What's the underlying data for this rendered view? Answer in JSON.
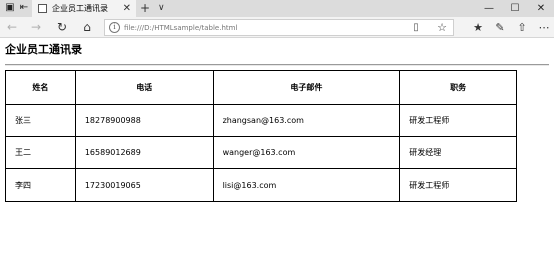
{
  "browser": {
    "tab_title": "企业员工通讯录",
    "url": "file:///D:/HTMLsample/table.html",
    "icons": {
      "tab_actions": "tab-actions-icon",
      "aside": "set-aside-tabs-icon",
      "back": "back-arrow-icon",
      "forward": "forward-arrow-icon",
      "refresh": "refresh-icon",
      "home": "home-icon",
      "site_info": "info-icon",
      "reading_view": "reading-view-icon",
      "favorite": "star-icon",
      "favorites_list": "favorites-list-icon",
      "notes": "pen-icon",
      "share": "share-icon",
      "more": "more-icon",
      "minimize": "minimize-icon",
      "maximize": "maximize-icon",
      "close": "close-icon"
    }
  },
  "page": {
    "title": "企业员工通讯录"
  },
  "table": {
    "headers": [
      "姓名",
      "电话",
      "电子邮件",
      "职务"
    ],
    "rows": [
      [
        "张三",
        "18278900988",
        "zhangsan@163.com",
        "研发工程师"
      ],
      [
        "王二",
        "16589012689",
        "wanger@163.com",
        "研发经理"
      ],
      [
        "李四",
        "17230019065",
        "lisi@163.com",
        "研发工程师"
      ]
    ]
  }
}
